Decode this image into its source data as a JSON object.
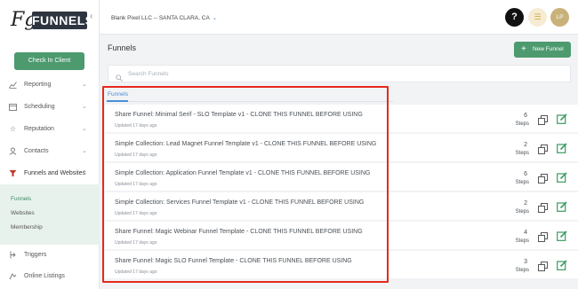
{
  "brand": {
    "logo_fg": "Fg",
    "logo_word": "FUNNELS"
  },
  "sidebar": {
    "checkin_label": "Check In Client",
    "items": [
      {
        "label": "Reporting",
        "icon": "chart-icon"
      },
      {
        "label": "Scheduling",
        "icon": "calendar-icon"
      },
      {
        "label": "Reputation",
        "icon": "star-icon"
      },
      {
        "label": "Contacts",
        "icon": "person-icon"
      },
      {
        "label": "Funnels and Websites",
        "icon": "funnel-icon"
      },
      {
        "label": "Triggers",
        "icon": "trigger-icon"
      },
      {
        "label": "Online Listings",
        "icon": "listing-icon"
      }
    ],
    "subitems": [
      "Funnels",
      "Websites",
      "Membership"
    ]
  },
  "topbar": {
    "company": "Blank Pixel LLC -- SANTA CLARA, CA",
    "help_label": "?",
    "avatar_initials": "LP"
  },
  "main": {
    "title": "Funnels",
    "new_button": "New Funnel",
    "search_placeholder": "Search Funnels",
    "tab": "Funnels",
    "rows": [
      {
        "title": "Share Funnel: Minimal Serif - SLO Template v1 - CLONE THIS FUNNEL BEFORE USING",
        "updated": "Updated 17 days ago",
        "steps": "6",
        "steps_label": "Steps"
      },
      {
        "title": "Simple Collection: Lead Magnet Funnel Template v1 - CLONE THIS FUNNEL BEFORE USING",
        "updated": "Updated 17 days ago",
        "steps": "2",
        "steps_label": "Steps"
      },
      {
        "title": "Simple Collection: Application Funnel Template v1 - CLONE THIS FUNNEL BEFORE USING",
        "updated": "Updated 17 days ago",
        "steps": "6",
        "steps_label": "Steps"
      },
      {
        "title": "Simple Collection: Services Funnel Template v1 - CLONE THIS FUNNEL BEFORE USING",
        "updated": "Updated 17 days ago",
        "steps": "2",
        "steps_label": "Steps"
      },
      {
        "title": "Share Funnel: Magic Webinar Funnel Template - CLONE THIS FUNNEL BEFORE USING",
        "updated": "Updated 17 days ago",
        "steps": "4",
        "steps_label": "Steps"
      },
      {
        "title": "Share Funnel: Magic SLO Funnel Template - CLONE THIS FUNNEL BEFORE USING",
        "updated": "Updated 17 days ago",
        "steps": "3",
        "steps_label": "Steps"
      }
    ]
  },
  "colors": {
    "primary_green": "#4d9a6f",
    "link_blue": "#4a90d9",
    "highlight_red": "#e52a1c"
  }
}
